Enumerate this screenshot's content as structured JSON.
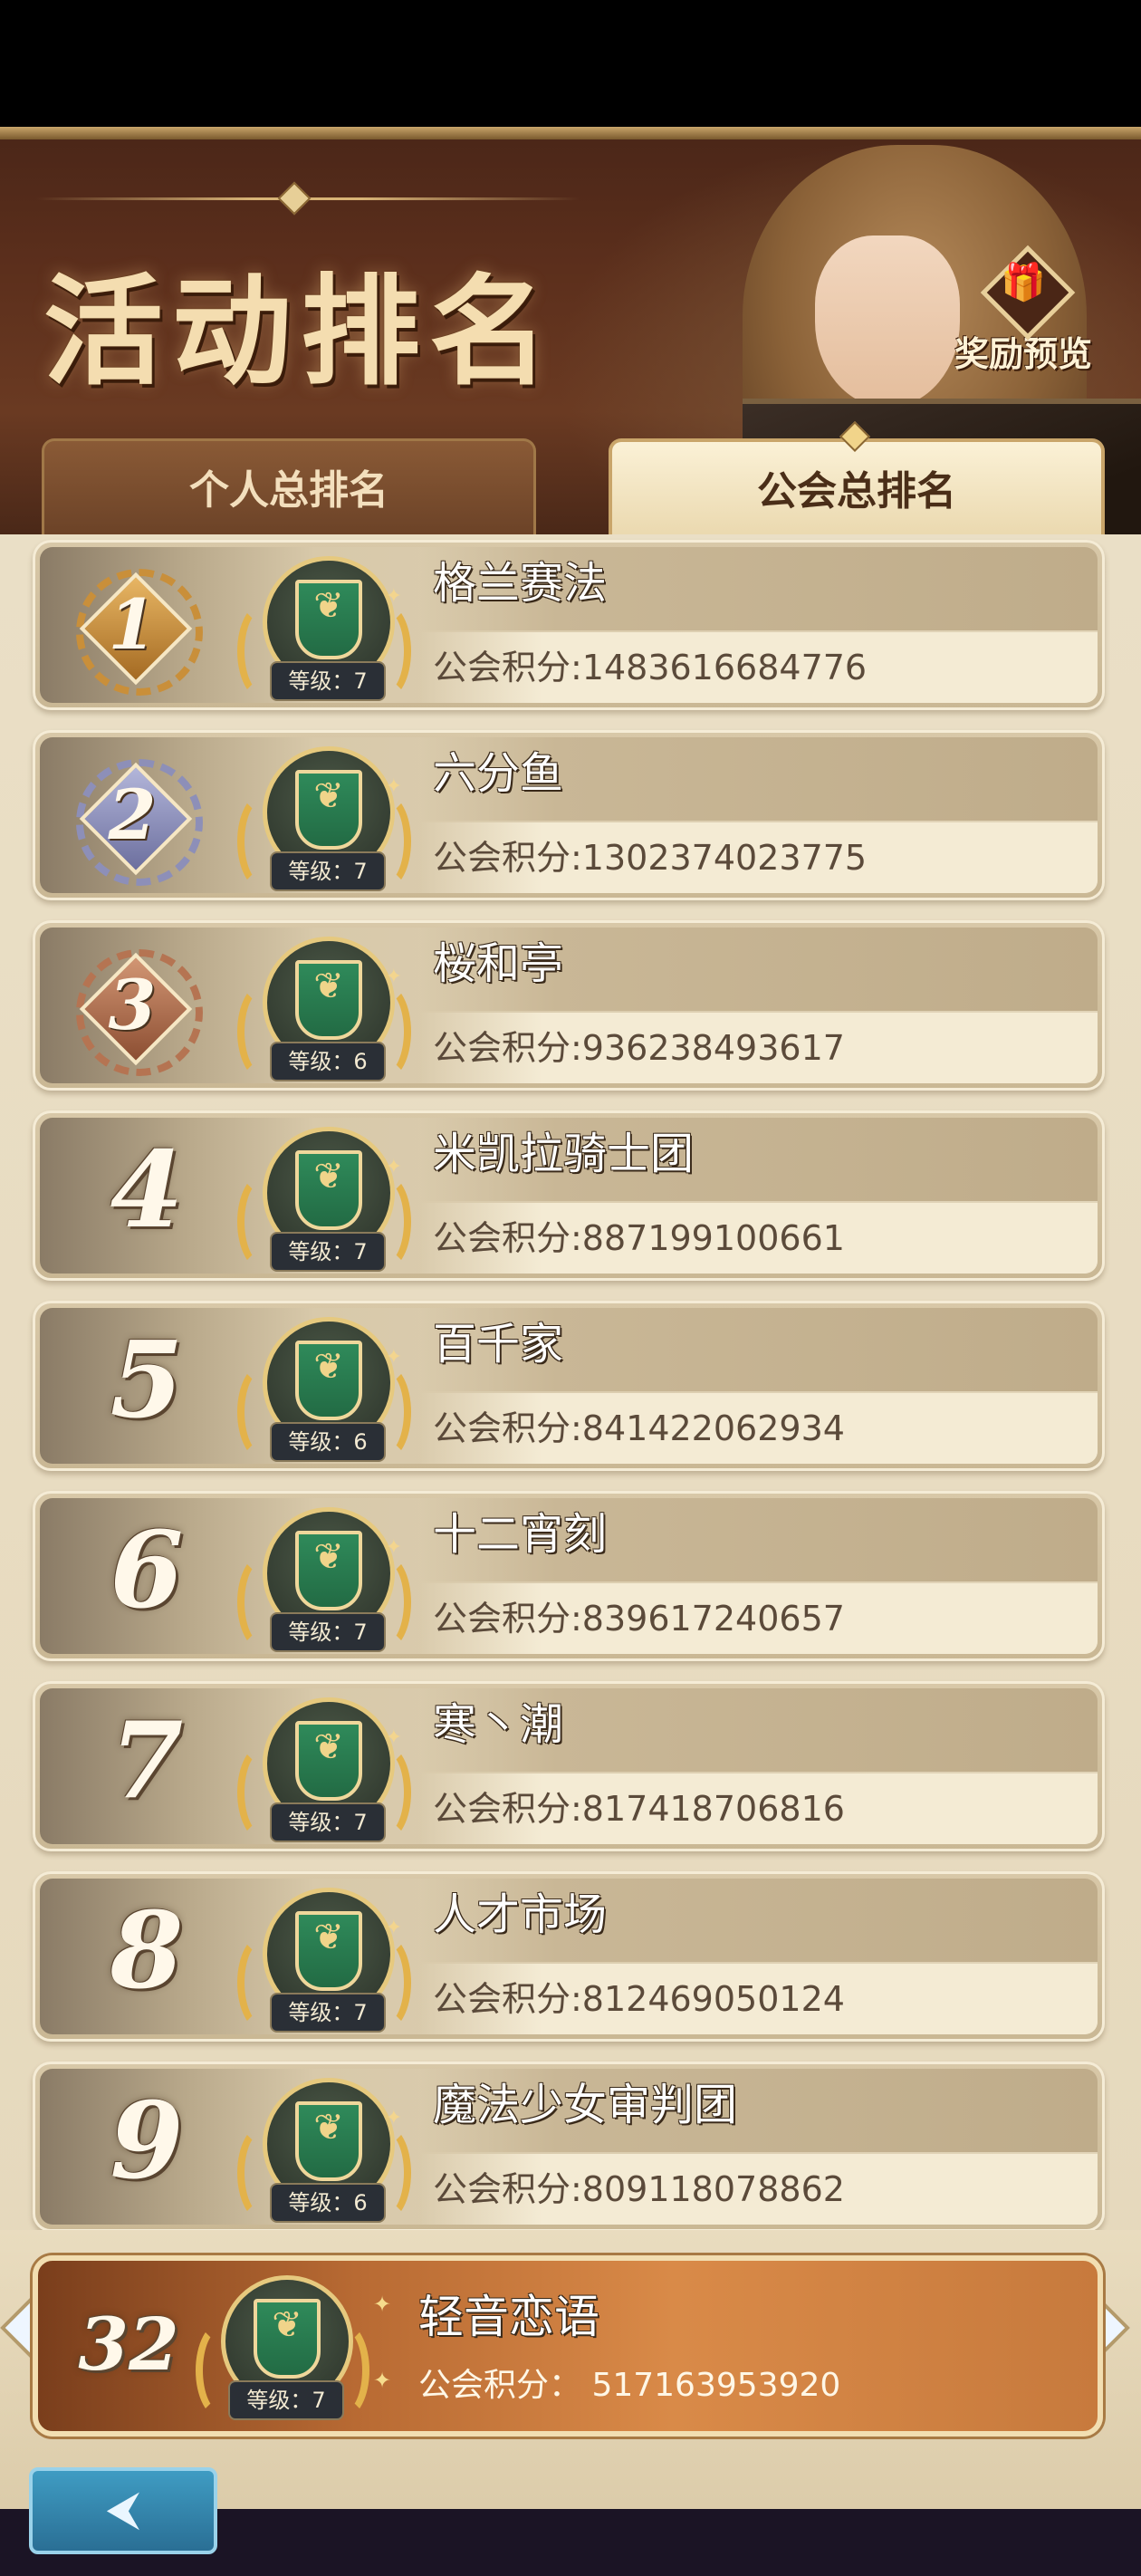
{
  "header": {
    "title": "活动排名",
    "reward_label": "奖励预览",
    "reward_icon": "gift-icon"
  },
  "tabs": [
    {
      "label": "个人总排名",
      "active": false
    },
    {
      "label": "公会总排名",
      "active": true
    }
  ],
  "rankings": [
    {
      "rank": "1",
      "name": "格兰赛法",
      "level": "等级：7",
      "score": "公会积分:1483616684776",
      "medal": "gold"
    },
    {
      "rank": "2",
      "name": "六分鱼",
      "level": "等级：7",
      "score": "公会积分:1302374023775",
      "medal": "silver"
    },
    {
      "rank": "3",
      "name": "桜和亭",
      "level": "等级：6",
      "score": "公会积分:936238493617",
      "medal": "bronze"
    },
    {
      "rank": "4",
      "name": "米凯拉骑士团",
      "level": "等级：7",
      "score": "公会积分:887199100661"
    },
    {
      "rank": "5",
      "name": "百千家",
      "level": "等级：6",
      "score": "公会积分:841422062934"
    },
    {
      "rank": "6",
      "name": "十二宵刻",
      "level": "等级：7",
      "score": "公会积分:839617240657"
    },
    {
      "rank": "7",
      "name": "寒丶潮",
      "level": "等级：7",
      "score": "公会积分:817418706816"
    },
    {
      "rank": "8",
      "name": "人才市场",
      "level": "等级：7",
      "score": "公会积分:812469050124"
    },
    {
      "rank": "9",
      "name": "魔法少女审判团",
      "level": "等级：6",
      "score": "公会积分:809118078862"
    }
  ],
  "my_rank": {
    "rank": "32",
    "name": "轻音恋语",
    "level": "等级：7",
    "score": "公会积分： 517163953920"
  },
  "back_icon": "back-arrow-icon"
}
